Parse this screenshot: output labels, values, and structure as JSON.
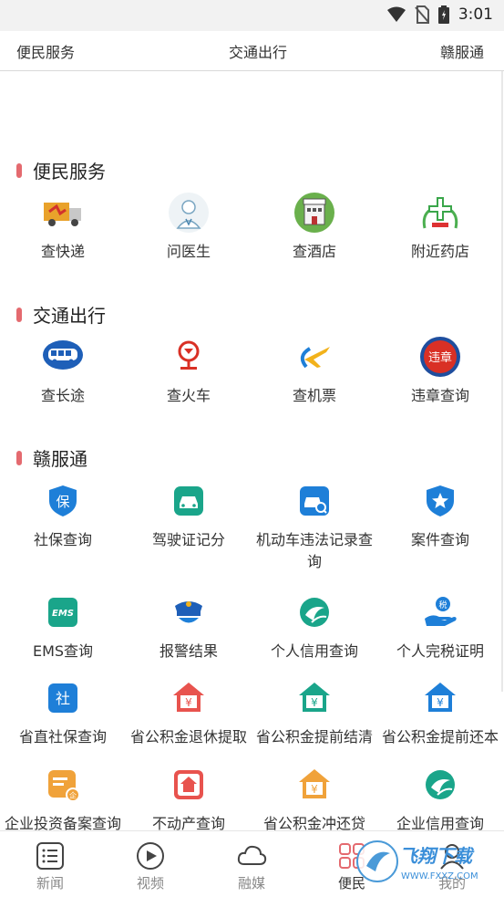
{
  "status_bar": {
    "time": "3:01",
    "icons": [
      "wifi-icon",
      "no-sim-icon",
      "battery-icon"
    ]
  },
  "top_tabs": [
    "便民服务",
    "交通出行",
    "赣服通"
  ],
  "sections": {
    "convenience": {
      "title": "便民服务",
      "items": [
        {
          "label": "查快递",
          "icon": "delivery-truck-icon"
        },
        {
          "label": "问医生",
          "icon": "doctor-icon"
        },
        {
          "label": "查酒店",
          "icon": "hotel-icon"
        },
        {
          "label": "附近药店",
          "icon": "pharmacy-icon"
        }
      ]
    },
    "traffic": {
      "title": "交通出行",
      "items": [
        {
          "label": "查长途",
          "icon": "bus-icon"
        },
        {
          "label": "查火车",
          "icon": "railway-icon"
        },
        {
          "label": "查机票",
          "icon": "airplane-icon"
        },
        {
          "label": "违章查询",
          "icon": "violation-icon",
          "icon_text": "违章"
        }
      ]
    },
    "ganfutong": {
      "title": "赣服通",
      "items": [
        {
          "label": "社保查询",
          "icon": "social-security-icon",
          "icon_text": "保"
        },
        {
          "label": "驾驶证记分",
          "icon": "car-icon"
        },
        {
          "label": "机动车违法记录查询",
          "label_line1": "机动车违法记录查",
          "label_line2": "询",
          "icon": "vehicle-search-icon"
        },
        {
          "label": "案件查询",
          "icon": "case-star-icon"
        },
        {
          "label": "EMS查询",
          "icon": "ems-icon",
          "icon_text": "EMS"
        },
        {
          "label": "报警结果",
          "icon": "police-icon"
        },
        {
          "label": "个人信用查询",
          "icon": "credit-icon"
        },
        {
          "label": "个人完税证明",
          "icon": "tax-hand-icon",
          "icon_text": "税"
        },
        {
          "label": "省直社保查询",
          "icon": "social-security-provincial-icon",
          "icon_text": "社"
        },
        {
          "label": "省公积金退休提取",
          "icon": "fund-house-icon",
          "icon_text": "¥"
        },
        {
          "label": "省公积金提前结清",
          "icon": "fund-house-icon",
          "icon_text": "¥"
        },
        {
          "label": "省公积金提前还本",
          "icon": "fund-house-icon",
          "icon_text": "¥"
        },
        {
          "label": "企业投资备案查询",
          "icon": "enterprise-invest-icon",
          "icon_text": "企"
        },
        {
          "label": "不动产查询",
          "icon": "real-estate-icon"
        },
        {
          "label": "省公积金冲还贷",
          "icon": "fund-house-icon",
          "icon_text": "¥"
        },
        {
          "label": "企业信用查询",
          "icon": "credit-icon"
        }
      ]
    }
  },
  "bottom_nav": [
    {
      "label": "新闻",
      "icon": "news-icon"
    },
    {
      "label": "视频",
      "icon": "video-icon"
    },
    {
      "label": "融媒",
      "icon": "cloud-icon"
    },
    {
      "label": "便民",
      "icon": "grid-icon",
      "active": true
    },
    {
      "label": "我的",
      "icon": "profile-icon"
    }
  ],
  "watermark": {
    "text_cn": "飞翔下载",
    "text_url": "WWW.FXXZ.COM"
  },
  "colors": {
    "section_bar": "#e46a6f",
    "blue": "#1e7fd8",
    "green_teal": "#1aa58a",
    "red": "#e8534e",
    "orange": "#f0a23a"
  }
}
